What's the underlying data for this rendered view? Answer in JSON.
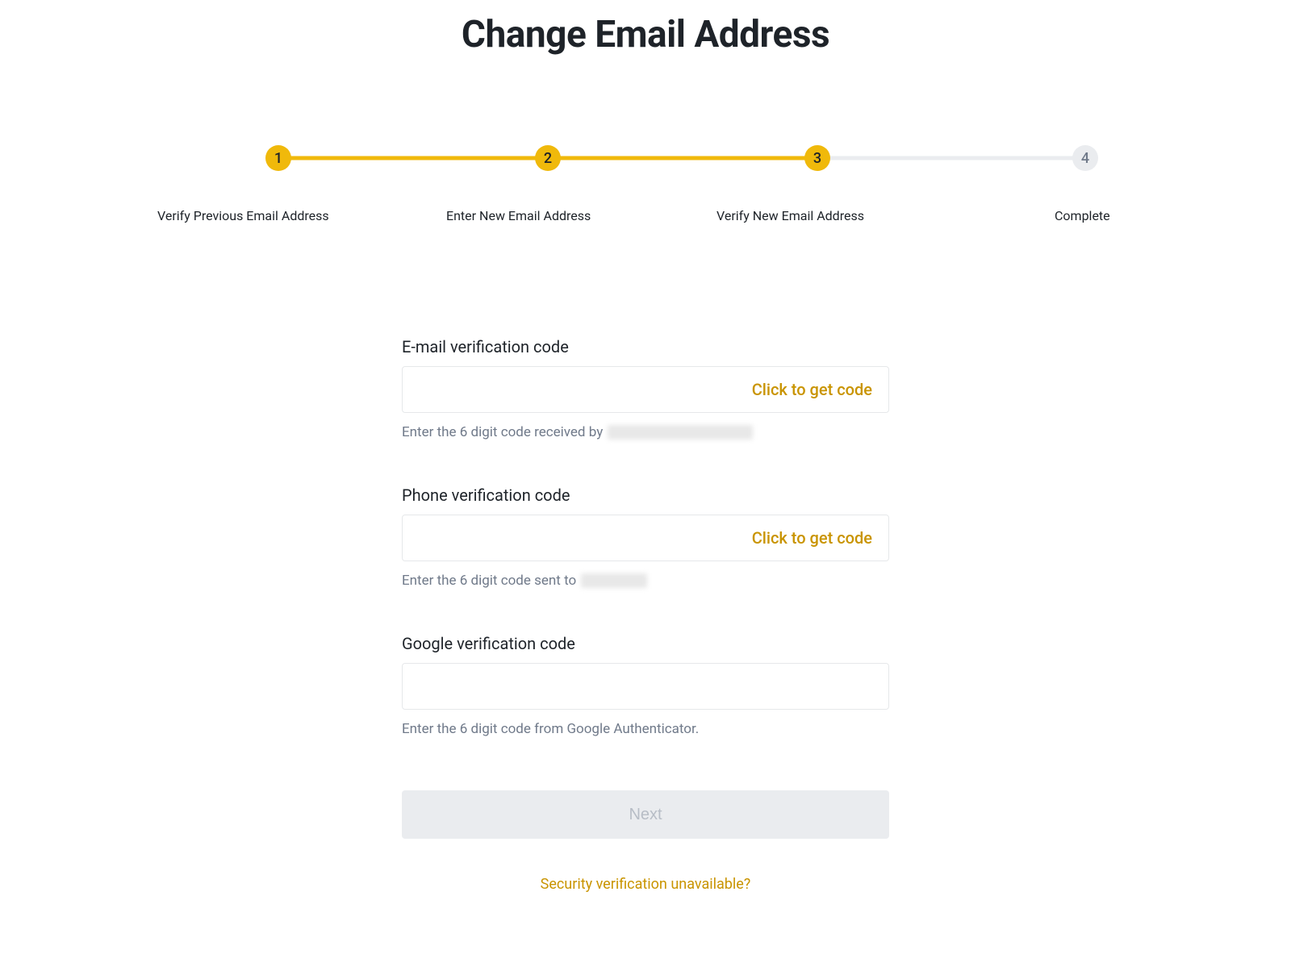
{
  "page": {
    "title": "Change Email Address"
  },
  "stepper": {
    "steps": [
      {
        "num": "1",
        "label": "Verify Previous Email Address",
        "active": true
      },
      {
        "num": "2",
        "label": "Enter New Email Address",
        "active": true
      },
      {
        "num": "3",
        "label": "Verify New Email Address",
        "active": true
      },
      {
        "num": "4",
        "label": "Complete",
        "active": false
      }
    ]
  },
  "form": {
    "email": {
      "label": "E-mail verification code",
      "get_code_label": "Click to get code",
      "hint_prefix": "Enter the 6 digit code received by"
    },
    "phone": {
      "label": "Phone verification code",
      "get_code_label": "Click to get code",
      "hint_prefix": "Enter the 6 digit code sent to"
    },
    "google": {
      "label": "Google verification code",
      "hint": "Enter the 6 digit code from Google Authenticator."
    },
    "next_button": "Next",
    "security_link": "Security verification unavailable?"
  }
}
